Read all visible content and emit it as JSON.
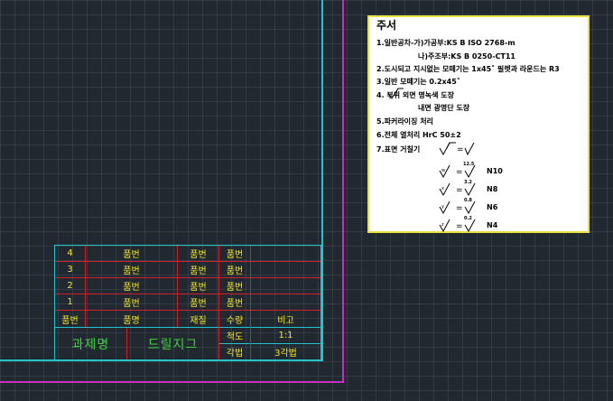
{
  "title_block": {
    "parts": [
      {
        "num": "4",
        "name": "품번",
        "material": "품번",
        "qty": "품번",
        "note": ""
      },
      {
        "num": "3",
        "name": "품번",
        "material": "품번",
        "qty": "품번",
        "note": ""
      },
      {
        "num": "2",
        "name": "품번",
        "material": "품번",
        "qty": "품번",
        "note": ""
      },
      {
        "num": "1",
        "name": "품번",
        "material": "품번",
        "qty": "품번",
        "note": ""
      }
    ],
    "header": {
      "num": "품번",
      "name": "품명",
      "material": "재질",
      "qty": "수량",
      "note": "비고"
    },
    "project_label": "과제명",
    "project_name": "드릴지그",
    "scale_label": "척도",
    "scale_value": "1:1",
    "projection_label": "각법",
    "projection_value": "3각법"
  },
  "notes": {
    "title": "주서",
    "lines": [
      "1.일반공차-가)가공부:KS B ISO 2768-m",
      "나)주조부:KS B 0250-CT11",
      "2.도시되고 지시없는 모떼기는 1x45˚ 필렛과 라운드는 R3",
      "3.일반 모떼기는 0.2x45˚",
      "4.  부위 외면 명녹색 도장",
      "내면 광명단 도장",
      "5.파커라이징 처리",
      "6.전체 열처리 HrC 50±2",
      "7.표면 거칠기"
    ],
    "roughness": [
      {
        "sym": "w",
        "over": "12.5",
        "grade": "N10"
      },
      {
        "sym": "x",
        "over": "3.2",
        "grade": "N8"
      },
      {
        "sym": "y",
        "over": "0.8",
        "grade": "N6"
      },
      {
        "sym": "z",
        "over": "0.2",
        "grade": "N4"
      }
    ]
  }
}
